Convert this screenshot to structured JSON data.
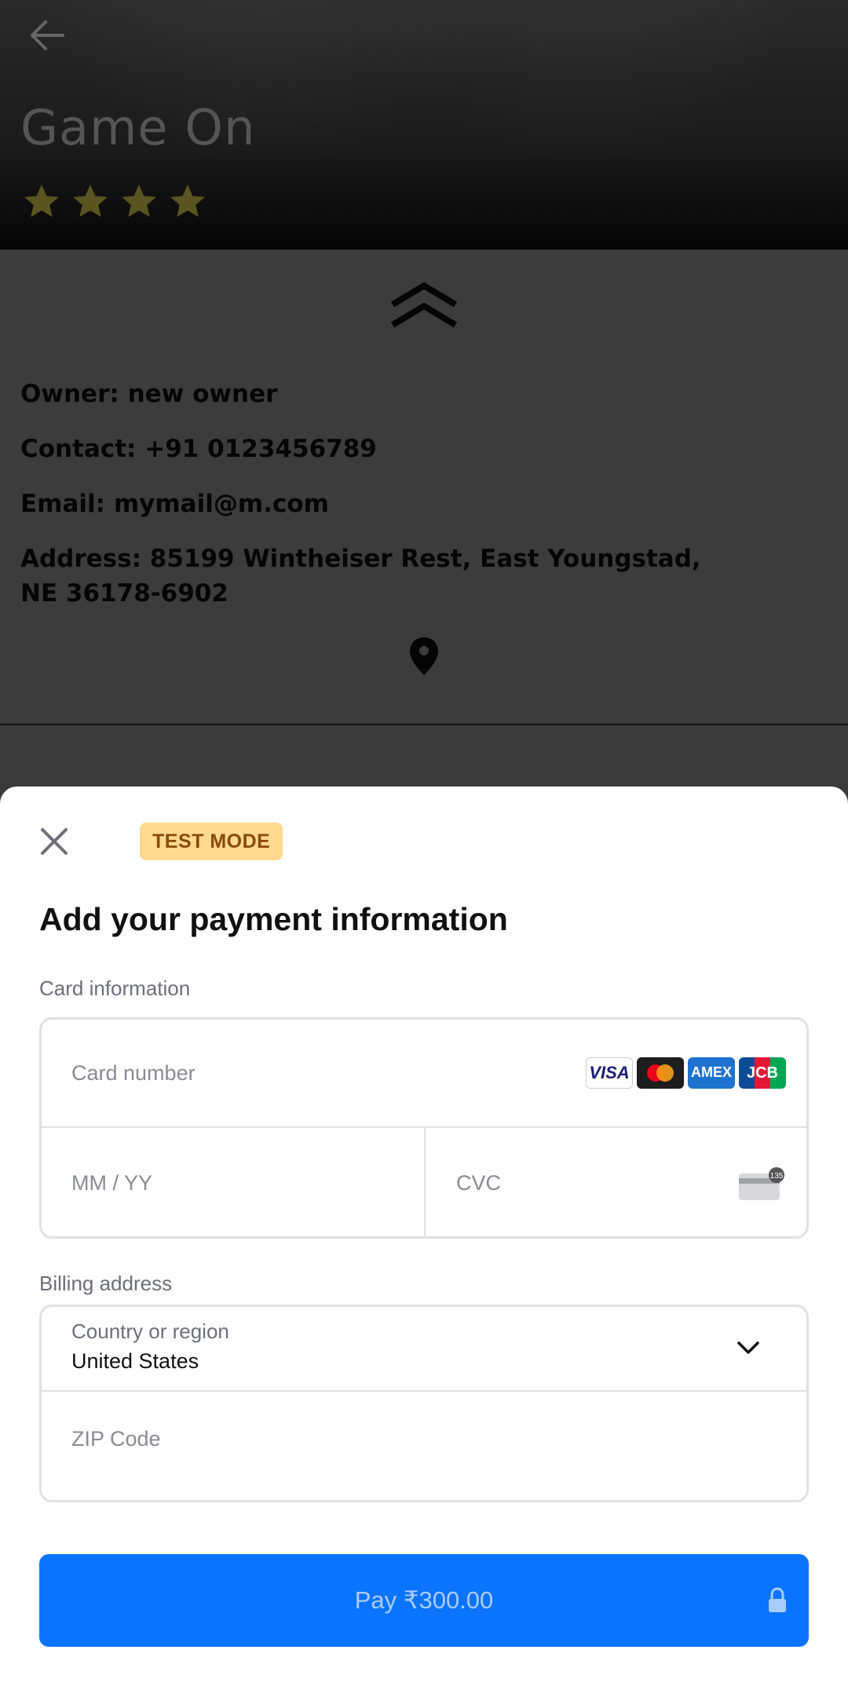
{
  "hero": {
    "title": "Game On",
    "rating": 4,
    "rating_max": 4
  },
  "details": {
    "owner": "Owner: new owner",
    "contact": "Contact: +91 0123456789",
    "email": "Email: mymail@m.com",
    "address": "Address: 85199 Wintheiser Rest, East Youngstad, NE 36178-6902"
  },
  "sheet": {
    "badge": "TEST MODE",
    "title": "Add your payment information",
    "card_section_label": "Card information",
    "card_number_placeholder": "Card number",
    "expiry_placeholder": "MM / YY",
    "cvc_placeholder": "CVC",
    "cvc_hint": "135",
    "card_brands": [
      "VISA",
      "Mastercard",
      "AMEX",
      "JCB"
    ],
    "billing_section_label": "Billing address",
    "country_label": "Country or region",
    "country_value": "United States",
    "zip_placeholder": "ZIP Code",
    "pay_label": "Pay ₹300.00"
  },
  "colors": {
    "accent": "#0a74ff",
    "badge_bg": "#ffd98e",
    "badge_text": "#8a4b06",
    "star": "#5a5420"
  },
  "icons": [
    "back-arrow-icon",
    "star-icon",
    "chevron-up-icon",
    "location-pin-icon",
    "close-icon",
    "cvc-card-icon",
    "chevron-down-icon",
    "lock-icon"
  ]
}
